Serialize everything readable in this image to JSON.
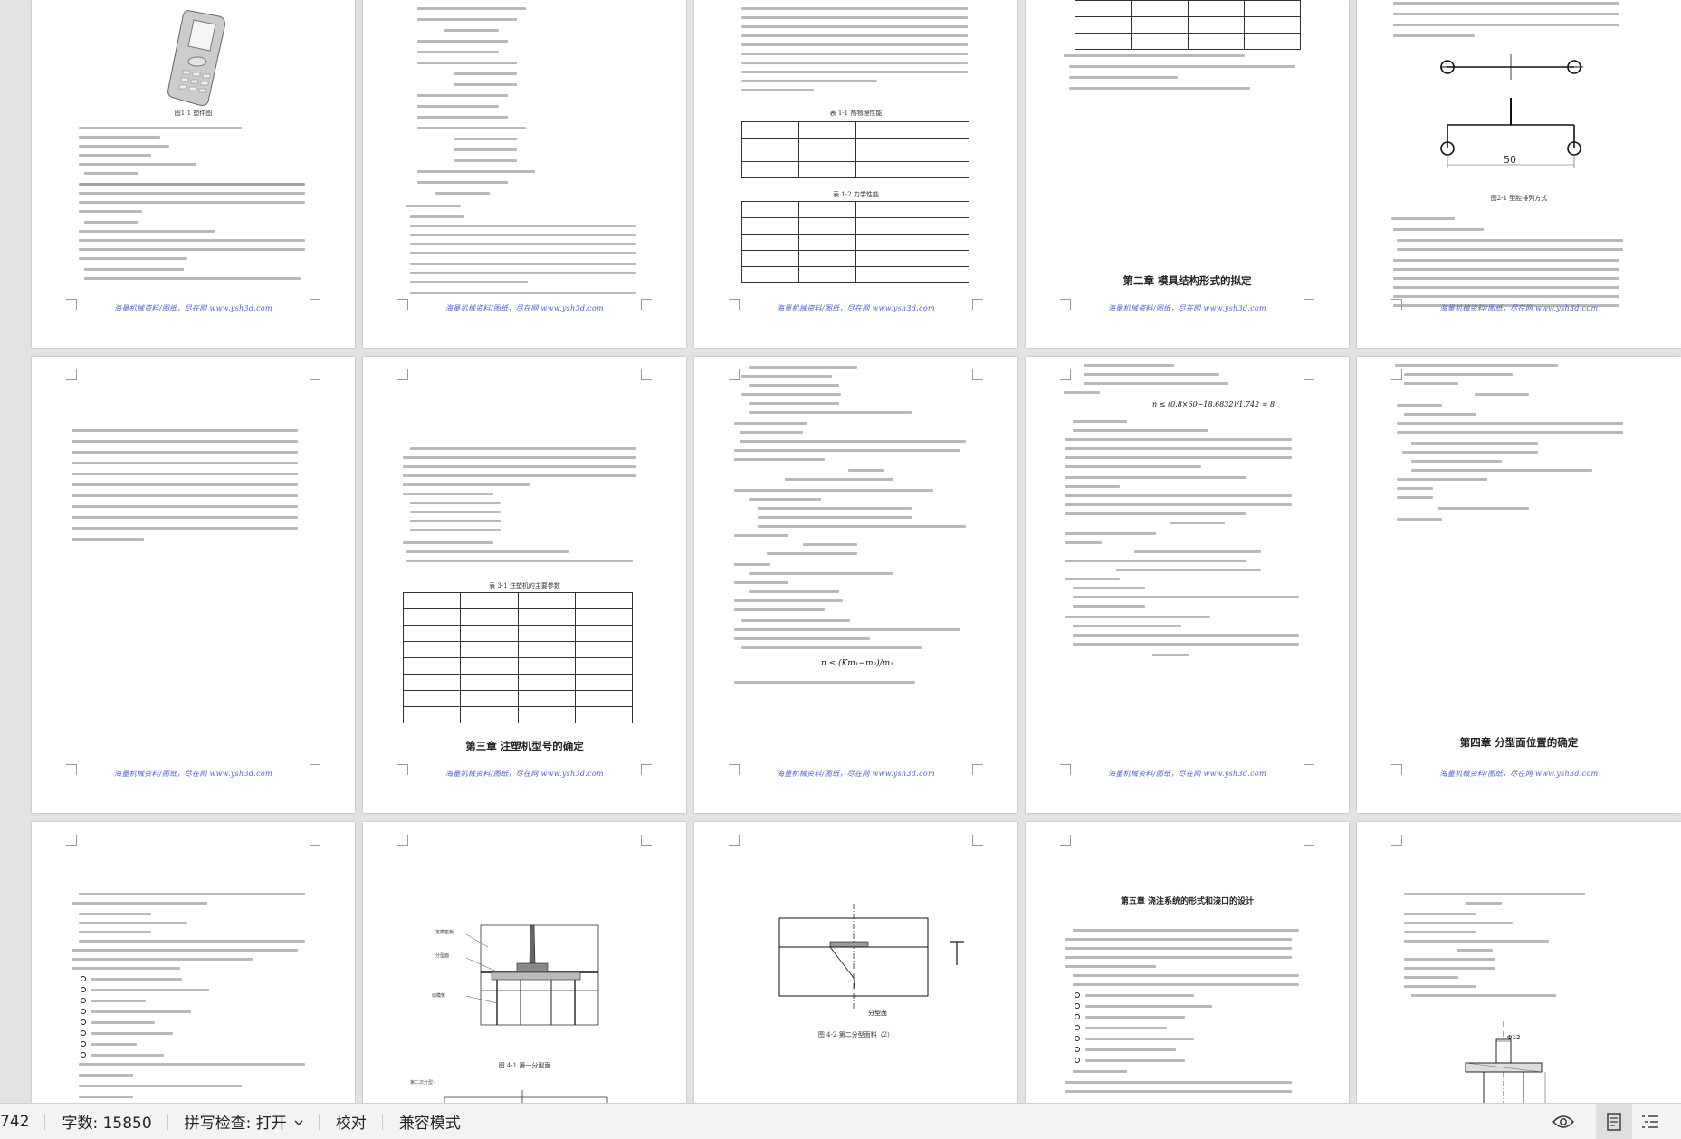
{
  "status_bar": {
    "page_counter_fragment": "742",
    "word_count": "字数: 15850",
    "spell_check": "拼写检查: 打开",
    "proofread": "校对",
    "compat_mode": "兼容模式",
    "spell_dropdown_icon": "chevron-down-icon",
    "view_icons": [
      "read-mode-icon",
      "print-layout-icon",
      "outline-icon"
    ]
  },
  "document": {
    "footer_text": "海量机械资料/图纸，尽在网 www.ysh3d.com",
    "page1": {
      "figure_caption": "图1-1   塑件图"
    },
    "page3": {
      "table1_caption": "表 1-1   热物理性能",
      "table2_caption": "表 1-2   力学性能"
    },
    "page4": {
      "chapter_title": "第二章    模具结构形式的拟定"
    },
    "page5": {
      "figure_caption": "图2-1   型腔排列方式",
      "dimension_label": "50"
    },
    "page7": {
      "table_caption": "表 3-1   注塑机的主要参数",
      "chapter_title": "第三章    注塑机型号的确定"
    },
    "page8": {
      "formula_main": "n ≤ (Km₁−m₂)/m₁"
    },
    "page9": {
      "formula_main": "n ≤ (0.8×60−18.6832)/1.742 ≈ 8"
    },
    "page10": {
      "chapter_title": "第四章    分型面位置的确定"
    },
    "page12": {
      "figure_caption": "图 4-1   第一分型面",
      "labels": [
        "定模座板",
        "分型面",
        "动模板"
      ],
      "subtitle": "第二次分型："
    },
    "page13": {
      "figure_caption": "图 4-2   第二分型面料（2）",
      "label": "分型面"
    },
    "page14": {
      "chapter_title": "第五章    浇注系统的形式和浇口的设计"
    },
    "page15": {
      "dimension_label": "Φ12"
    }
  },
  "colors": {
    "footer": "#4f64c8",
    "background": "#e3e3e3",
    "status_bar": "#f3f3f3"
  }
}
